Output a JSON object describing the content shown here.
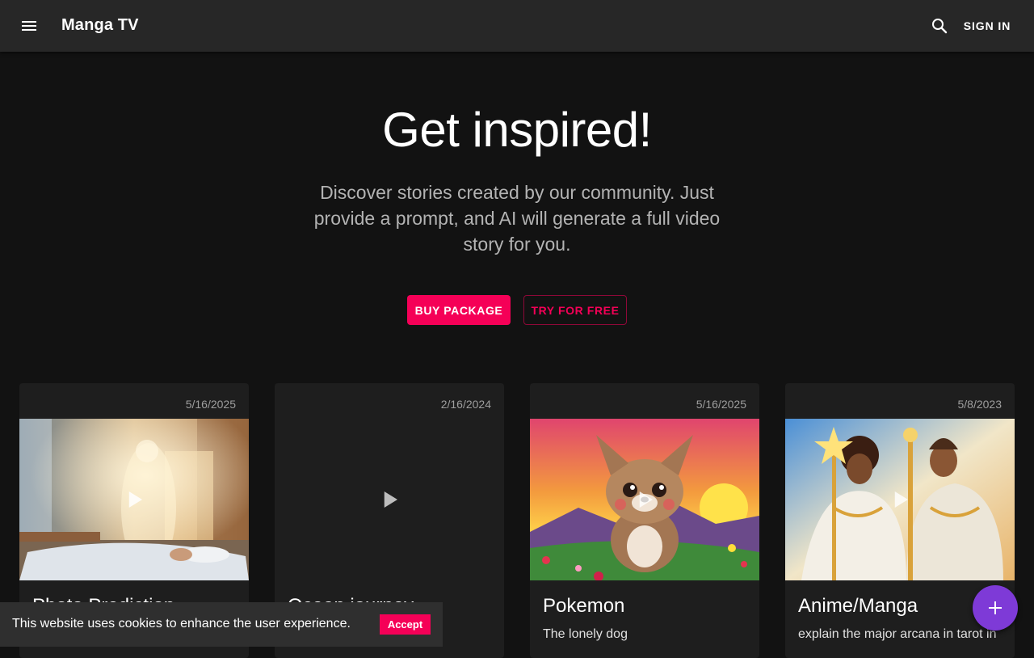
{
  "header": {
    "title": "Manga TV",
    "menu_icon": "menu-icon",
    "search_icon": "search-icon",
    "signin_label": "SIGN IN"
  },
  "hero": {
    "title": "Get inspired!",
    "subtitle": "Discover stories created by our community. Just provide a prompt, and AI will generate a full video story for you.",
    "buy_label": "BUY PACKAGE",
    "try_label": "TRY FOR FREE"
  },
  "cards": [
    {
      "date": "5/16/2025",
      "title": "Photo Prediction",
      "description": "",
      "image": "sunlit-bedroom-illustration"
    },
    {
      "date": "2/16/2024",
      "title": "Ocean journey",
      "description": "",
      "image": "none"
    },
    {
      "date": "5/16/2025",
      "title": "Pokemon",
      "description": "The lonely dog",
      "image": "puppy-sunset-illustration"
    },
    {
      "date": "5/8/2023",
      "title": "Anime/Manga",
      "description": "explain the major arcana in tarot in",
      "image": "tarot-anime-illustration"
    }
  ],
  "fab": {
    "icon": "plus-icon"
  },
  "cookie": {
    "text": "This website uses cookies to enhance the user experience.",
    "accept_label": "Accept"
  },
  "colors": {
    "accent": "#f50057",
    "fab": "#7e3ad7",
    "appbar": "#272727",
    "background": "#121212",
    "card": "#1e1e1e"
  }
}
